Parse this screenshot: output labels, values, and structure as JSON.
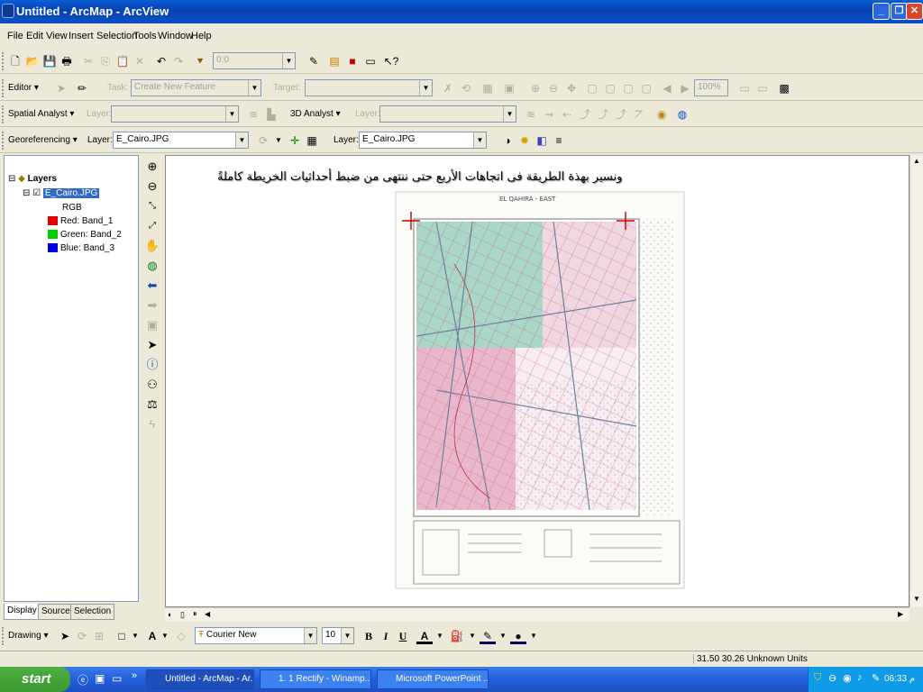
{
  "window": {
    "title": "Untitled - ArcMap - ArcView"
  },
  "menu": [
    "File",
    "Edit",
    "View",
    "Insert",
    "Selection",
    "Tools",
    "Window",
    "Help"
  ],
  "standard": {
    "scale_value": "0:0"
  },
  "editor": {
    "label": "Editor ▾",
    "task_label": "Task:",
    "task_value": "Create New Feature",
    "target_label": "Target:",
    "zoom_value": "100%"
  },
  "spatial": {
    "label": "Spatial Analyst ▾",
    "layer_label": "Layer:",
    "analyst3d_label": "3D Analyst ▾",
    "layer3d_label": "Layer:"
  },
  "georef": {
    "label": "Georeferencing ▾",
    "layer_label": "Layer:",
    "layer_value": "E_Cairo.JPG",
    "layer2_label": "Layer:",
    "layer2_value": "E_Cairo.JPG"
  },
  "toc": {
    "root": "Layers",
    "layer": "E_Cairo.JPG",
    "rgb": "RGB",
    "bands": [
      {
        "label": "Red:   Band_1",
        "color": "#e00000"
      },
      {
        "label": "Green: Band_2",
        "color": "#00d000"
      },
      {
        "label": "Blue:   Band_3",
        "color": "#0000e0"
      }
    ],
    "tabs": [
      "Display",
      "Source",
      "Selection"
    ]
  },
  "map": {
    "caption": "ونسير بهذة الطريقة فى اتجاهات الأربع حتى ننتهى من ضبط أحداثيات الخريطة كاملةً",
    "sheet_title": "EL QAHIRA - EAST"
  },
  "drawing": {
    "label": "Drawing ▾",
    "font": "Courier New",
    "size": "10",
    "bold": "B",
    "italic": "I",
    "underline": "U"
  },
  "status": {
    "coords": "31.50  30.26 Unknown Units"
  },
  "taskbar": {
    "start": "start",
    "tasks": [
      "Untitled - ArcMap - Ar...",
      "1. 1 Rectify - Winamp...",
      "Microsoft PowerPoint ..."
    ],
    "clock": "06:33 م"
  }
}
